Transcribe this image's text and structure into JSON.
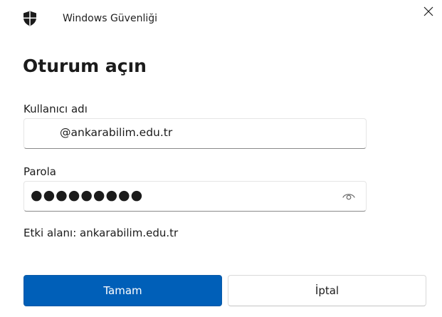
{
  "window": {
    "title": "Windows Güvenliği",
    "icons": {
      "app": "shield-icon",
      "close": "close-icon",
      "reveal": "eye-icon"
    }
  },
  "dialog": {
    "heading": "Oturum açın",
    "username": {
      "label": "Kullanıcı adı",
      "value": "@ankarabilim.edu.tr"
    },
    "password": {
      "label": "Parola",
      "masked_value": "●●●●●●●●●"
    },
    "domain_text": "Etki alanı: ankarabilim.edu.tr",
    "buttons": {
      "ok": "Tamam",
      "cancel": "İptal"
    }
  },
  "colors": {
    "primary_button": "#005fb8",
    "background": "#ffffff",
    "text": "#1b1b1b"
  }
}
